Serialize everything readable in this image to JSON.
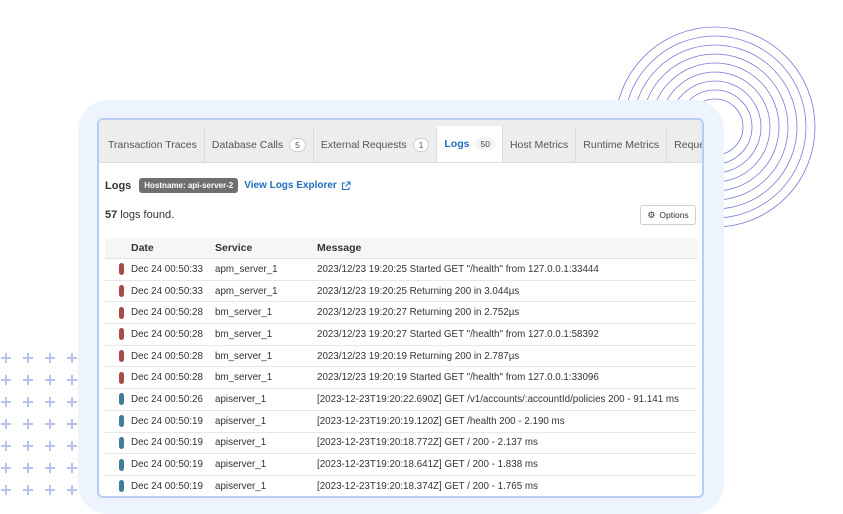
{
  "colors": {
    "error": "#a84a4a",
    "info": "#3f7f96",
    "accent": "#1e6fbf",
    "deco": "#7a7ad8",
    "plus": "#b7c3ee"
  },
  "tabs": [
    {
      "label": "Transaction Traces",
      "badge": null,
      "active": false
    },
    {
      "label": "Database Calls",
      "badge": "5",
      "active": false
    },
    {
      "label": "External Requests",
      "badge": "1",
      "active": false
    },
    {
      "label": "Logs",
      "badge": "50",
      "active": true
    },
    {
      "label": "Host Metrics",
      "badge": null,
      "active": false
    },
    {
      "label": "Runtime Metrics",
      "badge": null,
      "active": false
    },
    {
      "label": "Request Details",
      "badge": null,
      "active": false
    }
  ],
  "logs": {
    "title": "Logs",
    "hostname_badge": "Hostname: api-server-2",
    "explorer_link": "View Logs Explorer",
    "count": "57",
    "count_suffix": " logs found.",
    "options_label": "Options",
    "columns": {
      "date": "Date",
      "service": "Service",
      "message": "Message"
    },
    "rows": [
      {
        "level": "error",
        "date": "Dec 24 00:50:33",
        "service": "apm_server_1",
        "message": "2023/12/23 19:20:25 Started GET \"/health\" from 127.0.0.1:33444"
      },
      {
        "level": "error",
        "date": "Dec 24 00:50:33",
        "service": "apm_server_1",
        "message": "2023/12/23 19:20:25 Returning 200 in 3.044µs"
      },
      {
        "level": "error",
        "date": "Dec 24 00:50:28",
        "service": "bm_server_1",
        "message": "2023/12/23 19:20:27 Returning 200 in 2.752µs"
      },
      {
        "level": "error",
        "date": "Dec 24 00:50:28",
        "service": "bm_server_1",
        "message": "2023/12/23 19:20:27 Started GET \"/health\" from 127.0.0.1:58392"
      },
      {
        "level": "error",
        "date": "Dec 24 00:50:28",
        "service": "bm_server_1",
        "message": "2023/12/23 19:20:19 Returning 200 in 2.787µs"
      },
      {
        "level": "error",
        "date": "Dec 24 00:50:28",
        "service": "bm_server_1",
        "message": "2023/12/23 19:20:19 Started GET \"/health\" from 127.0.0.1:33096"
      },
      {
        "level": "info",
        "date": "Dec 24 00:50:26",
        "service": "apiserver_1",
        "message": "[2023-12-23T19:20:22.690Z] GET /v1/accounts/:accountId/policies 200 - 91.141 ms"
      },
      {
        "level": "info",
        "date": "Dec 24 00:50:19",
        "service": "apiserver_1",
        "message": "[2023-12-23T19:20:19.120Z] GET /health 200 - 2.190 ms"
      },
      {
        "level": "info",
        "date": "Dec 24 00:50:19",
        "service": "apiserver_1",
        "message": "[2023-12-23T19:20:18.772Z] GET / 200 - 2.137 ms"
      },
      {
        "level": "info",
        "date": "Dec 24 00:50:19",
        "service": "apiserver_1",
        "message": "[2023-12-23T19:20:18.641Z] GET / 200 - 1.838 ms"
      },
      {
        "level": "info",
        "date": "Dec 24 00:50:19",
        "service": "apiserver_1",
        "message": "[2023-12-23T19:20:18.374Z] GET / 200 - 1.765 ms"
      }
    ]
  }
}
